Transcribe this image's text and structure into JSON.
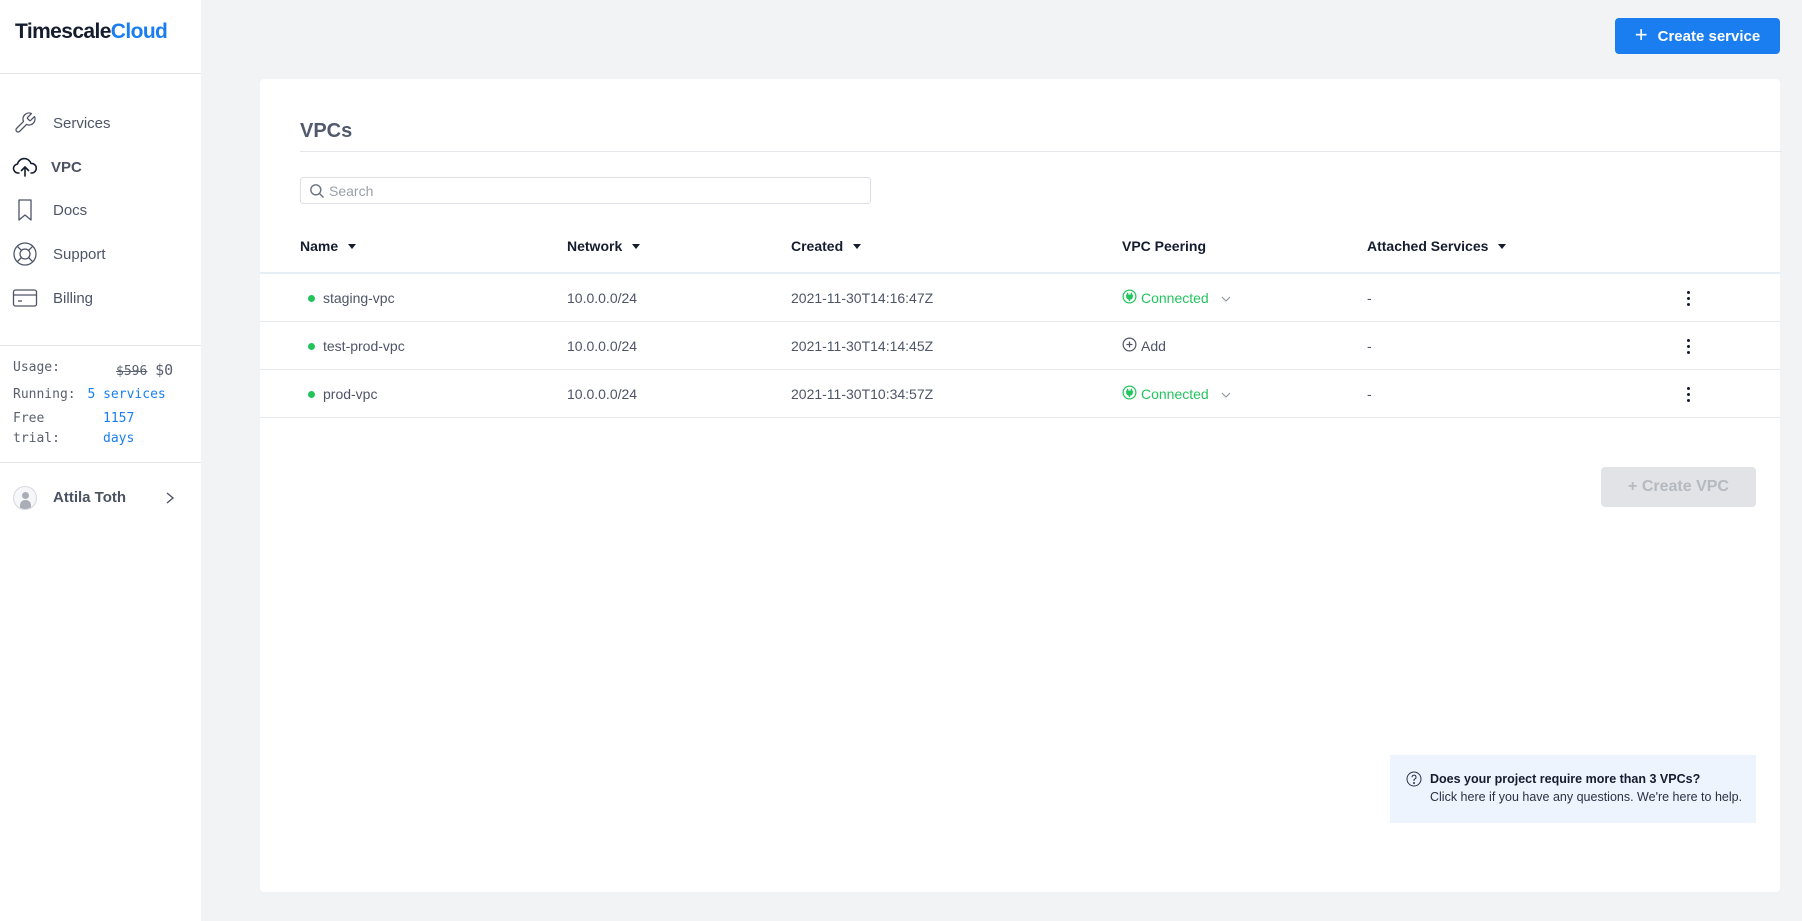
{
  "brand": {
    "part1": "Timescale",
    "part2": "Cloud"
  },
  "sidebar": {
    "items": [
      {
        "label": "Services",
        "icon": "wrench-icon"
      },
      {
        "label": "VPC",
        "icon": "cloud-upload-icon",
        "active": true
      },
      {
        "label": "Docs",
        "icon": "bookmark-icon"
      },
      {
        "label": "Support",
        "icon": "lifebuoy-icon"
      },
      {
        "label": "Billing",
        "icon": "credit-card-icon"
      }
    ],
    "stats": {
      "usage_label": "Usage:",
      "usage_original": "$596",
      "usage_current": "$0",
      "running_label": "Running:",
      "running_value": "5 services",
      "trial_label_1": "Free",
      "trial_label_2": "trial:",
      "trial_value_1": "1157",
      "trial_value_2": "days"
    },
    "user": {
      "name": "Attila Toth"
    }
  },
  "header": {
    "create_service_label": "Create service"
  },
  "main": {
    "title": "VPCs",
    "search": {
      "placeholder": "Search",
      "value": ""
    },
    "columns": [
      {
        "label": "Name",
        "sortable": true
      },
      {
        "label": "Network",
        "sortable": true
      },
      {
        "label": "Created",
        "sortable": true
      },
      {
        "label": "VPC Peering",
        "sortable": false
      },
      {
        "label": "Attached Services",
        "sortable": true
      }
    ],
    "rows": [
      {
        "name": "staging-vpc",
        "status": "active",
        "network": "10.0.0.0/24",
        "created": "2021-11-30T14:16:47Z",
        "peering": "Connected",
        "peering_state": "connected",
        "attached": "-"
      },
      {
        "name": "test-prod-vpc",
        "status": "active",
        "network": "10.0.0.0/24",
        "created": "2021-11-30T14:14:45Z",
        "peering": "Add",
        "peering_state": "add",
        "attached": "-"
      },
      {
        "name": "prod-vpc",
        "status": "active",
        "network": "10.0.0.0/24",
        "created": "2021-11-30T10:34:57Z",
        "peering": "Connected",
        "peering_state": "connected",
        "attached": "-"
      }
    ],
    "create_vpc_label": "+ Create VPC",
    "info": {
      "title": "Does your project require more than 3 VPCs?",
      "text": "Click here if you have any questions. We're here to help."
    }
  },
  "colors": {
    "accent": "#1a7ef0",
    "success": "#23c45e",
    "disabled_bg": "#e1e3e6",
    "info_bg": "#edf4fe"
  }
}
